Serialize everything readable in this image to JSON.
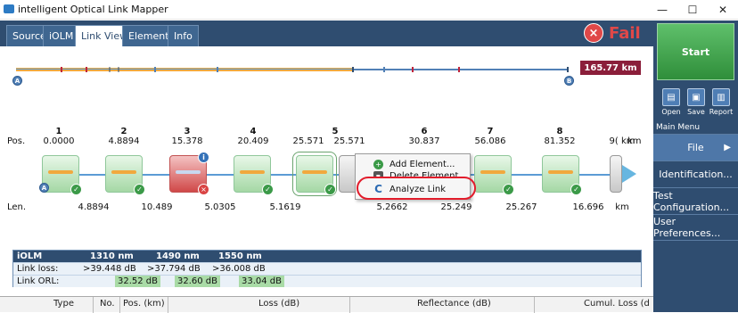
{
  "window": {
    "title": "intelligent Optical Link Mapper"
  },
  "tabs": [
    "Source",
    "iOLM",
    "Link View",
    "Elements",
    "Info"
  ],
  "status": {
    "verdict": "Fail",
    "fail_symbol": "×"
  },
  "link": {
    "total_length": "165.77 km",
    "start_marker": "A",
    "end_marker": "B"
  },
  "elements_row": {
    "pos_label": "Pos.",
    "len_label": "Len.",
    "km_unit": "km",
    "numbers": [
      "1",
      "2",
      "3",
      "4",
      "5",
      "6",
      "7",
      "8"
    ],
    "positions": [
      "0.0000",
      "4.8894",
      "15.378",
      "20.409",
      "25.571",
      "25.571",
      "30.837",
      "56.086",
      "81.352",
      "9( km"
    ],
    "lengths": [
      "4.8894",
      "10.489",
      "5.0305",
      "5.1619",
      "5.2662",
      "25.249",
      "25.267",
      "16.696",
      "km"
    ]
  },
  "context_menu": {
    "items": [
      "Add Element...",
      "Delete Element",
      "Analyze Link"
    ]
  },
  "summary": {
    "header": [
      "iOLM",
      "1310 nm",
      "1490 nm",
      "1550 nm"
    ],
    "link_loss": {
      "label": "Link loss:",
      "values": [
        ">39.448 dB",
        ">37.794 dB",
        ">36.008 dB"
      ]
    },
    "link_orl": {
      "label": "Link ORL:",
      "values": [
        "32.52 dB",
        "32.60 dB",
        "33.04 dB"
      ]
    }
  },
  "table": {
    "columns": [
      "Type",
      "No.",
      "Pos. (km)",
      "Loss (dB)",
      "Reflectance (dB)",
      "Cumul. Loss (d"
    ]
  },
  "sidebar": {
    "start_label": "Start",
    "tools": [
      "Open",
      "Save",
      "Report"
    ],
    "main_menu_title": "Main Menu",
    "menu_items": [
      "File",
      "Identification...",
      "Test Configuration...",
      "User Preferences..."
    ]
  },
  "colors": {
    "brand": "#2f4d70",
    "fail": "#e04848",
    "ok": "#3b9a48",
    "highlight": "#e21c2b"
  }
}
